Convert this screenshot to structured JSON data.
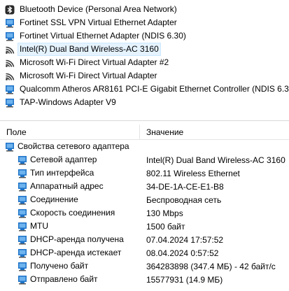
{
  "adapters": [
    {
      "icon": "bluetooth-icon",
      "label": "Bluetooth Device (Personal Area Network)"
    },
    {
      "icon": "network-adapter-icon",
      "label": "Fortinet SSL VPN Virtual Ethernet Adapter"
    },
    {
      "icon": "network-adapter-icon",
      "label": "Fortinet Virtual Ethernet Adapter (NDIS 6.30)"
    },
    {
      "icon": "wifi-icon",
      "label": "Intel(R) Dual Band Wireless-AC 3160",
      "selected": true
    },
    {
      "icon": "wifi-icon",
      "label": "Microsoft Wi-Fi Direct Virtual Adapter #2"
    },
    {
      "icon": "wifi-icon",
      "label": "Microsoft Wi-Fi Direct Virtual Adapter"
    },
    {
      "icon": "network-adapter-icon",
      "label": "Qualcomm Atheros AR8161 PCI-E Gigabit Ethernet Controller (NDIS 6.30)"
    },
    {
      "icon": "network-adapter-icon",
      "label": "TAP-Windows Adapter V9"
    }
  ],
  "details": {
    "header": {
      "field": "Поле",
      "value": "Значение"
    },
    "group_label": "Свойства сетевого адаптера",
    "rows": [
      {
        "field": "Сетевой адаптер",
        "value": "Intel(R) Dual Band Wireless-AC 3160"
      },
      {
        "field": "Тип интерфейса",
        "value": "802.11 Wireless Ethernet"
      },
      {
        "field": "Аппаратный адрес",
        "value": "34-DE-1A-CE-E1-B8"
      },
      {
        "field": "Соединение",
        "value": "Беспроводная сеть"
      },
      {
        "field": "Скорость соединения",
        "value": "130 Mbps"
      },
      {
        "field": "MTU",
        "value": "1500 байт"
      },
      {
        "field": "DHCP-аренда получена",
        "value": "07.04.2024 17:57:52"
      },
      {
        "field": "DHCP-аренда истекает",
        "value": "08.04.2024 0:57:52"
      },
      {
        "field": "Получено байт",
        "value": "364283898 (347.4 МБ) - 42 байт/с"
      },
      {
        "field": "Отправлено байт",
        "value": "15577931 (14.9 МБ)"
      }
    ]
  },
  "colors": {
    "icon_blue": "#1e73c8",
    "selection_bg": "#e5f3ff",
    "wifi_dark": "#3a3a3a"
  }
}
